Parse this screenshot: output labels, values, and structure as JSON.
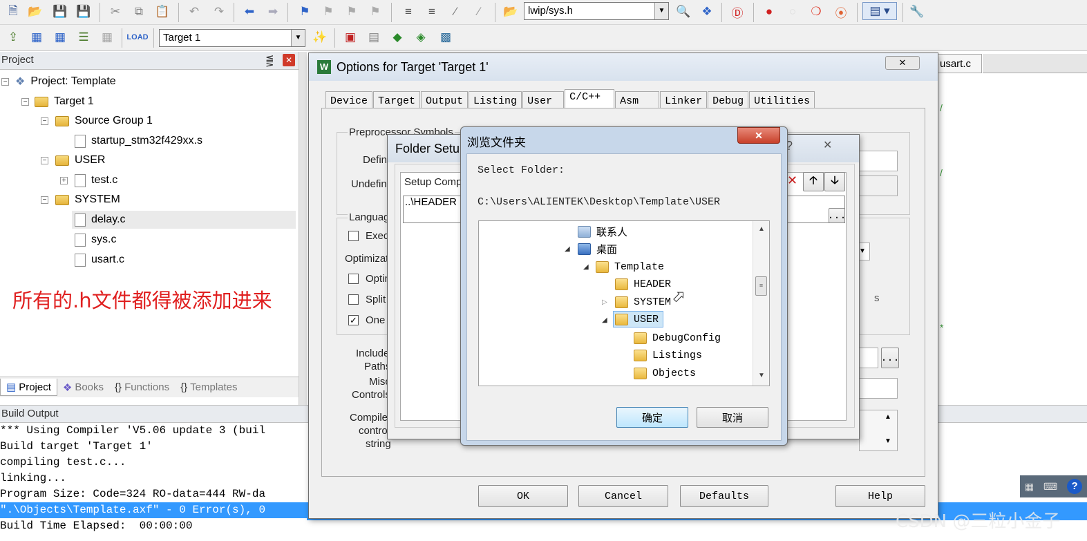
{
  "toolbar1": {
    "file_combo": "lwip/sys.h"
  },
  "toolbar2": {
    "target_combo": "Target 1"
  },
  "project_pane": {
    "title": "Project",
    "tree": {
      "project": "Project: Template",
      "target": "Target 1",
      "group1": "Source Group 1",
      "startup": "startup_stm32f429xx.s",
      "user": "USER",
      "test": "test.c",
      "system": "SYSTEM",
      "delay": "delay.c",
      "sys": "sys.c",
      "usart": "usart.c"
    },
    "annotation": "所有的.h文件都得被添加进来",
    "bottom_tabs": {
      "project": "Project",
      "books": "Books",
      "functions": "Functions",
      "templates": "Templates"
    }
  },
  "editor": {
    "tab_usart": "usart.c"
  },
  "build_output": {
    "title": "Build Output",
    "lines": [
      "*** Using Compiler 'V5.06 update 3 (buil",
      "Build target 'Target 1'",
      "compiling test.c...",
      "linking...",
      "Program Size: Code=324 RO-data=444 RW-da",
      "\".\\Objects\\Template.axf\" - 0 Error(s), 0",
      "Build Time Elapsed:  00:00:00"
    ]
  },
  "options_dialog": {
    "title": "Options for Target 'Target 1'",
    "tabs": [
      "Device",
      "Target",
      "Output",
      "Listing",
      "User",
      "C/C++",
      "Asm",
      "Linker",
      "Debug",
      "Utilities"
    ],
    "preprocessor": "Preprocessor Symbols",
    "define": "Defin",
    "undefine": "Undefin",
    "language": "Languag",
    "exec": "Exec",
    "optimization": "Optimizat",
    "optim": "Optin",
    "split": "Split",
    "one": "One",
    "include_paths_1": "Include",
    "include_paths_2": "Paths",
    "misc_1": "Misc",
    "misc_2": "Controls",
    "compiler_1": "Compile",
    "compiler_2": "contro",
    "compiler_3": "string",
    "ok": "OK",
    "cancel": "Cancel",
    "defaults": "Defaults",
    "help": "Help"
  },
  "folder_setup": {
    "title": "Folder Setu",
    "setup_label": "Setup Comp",
    "entry": "..\\HEADER"
  },
  "browse_dialog": {
    "title": "浏览文件夹",
    "prompt": "Select Folder:",
    "path": "C:\\Users\\ALIENTEK\\Desktop\\Template\\USER",
    "items": {
      "contacts": "联系人",
      "desktop": "桌面",
      "template": "Template",
      "header": "HEADER",
      "system": "SYSTEM",
      "user": "USER",
      "debugconfig": "DebugConfig",
      "listings": "Listings",
      "objects": "Objects"
    },
    "ok": "确定",
    "cancel": "取消"
  },
  "watermark": "CSDN @三粒小金子",
  "colors": {
    "selection": "#3399ff",
    "annotation": "#e02020",
    "output_highlight": "#3399ff"
  }
}
